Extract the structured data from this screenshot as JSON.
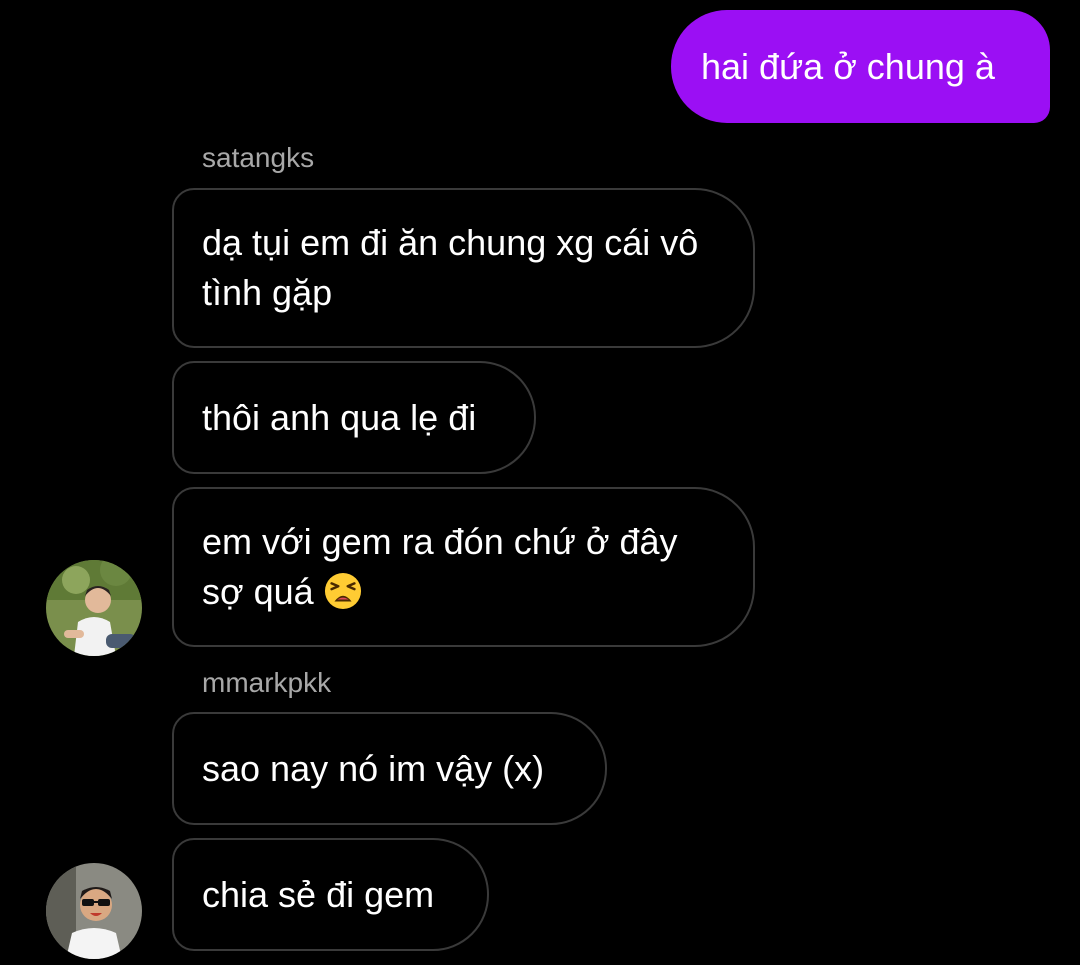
{
  "colors": {
    "background": "#000000",
    "outgoing_bubble": "#9b0ff4",
    "incoming_border": "#3a3a3a",
    "sender_name": "#a8a8a8"
  },
  "messages": {
    "outgoing_1": "hai đứa ở chung à",
    "group1": {
      "sender": "satangks",
      "msg1": "dạ tụi em đi ăn chung xg cái vô tình gặp",
      "msg2": "thôi anh qua lẹ đi",
      "msg3": "em với gem ra đón chứ ở đây sợ quá",
      "msg3_emoji": "tired-face-emoji"
    },
    "group2": {
      "sender": "mmarkpkk",
      "msg1": "sao nay nó im vậy (x)",
      "msg2": "chia sẻ đi gem"
    }
  },
  "avatars": {
    "satangks": "avatar-satangks",
    "mmarkpkk": "avatar-mmarkpkk"
  }
}
